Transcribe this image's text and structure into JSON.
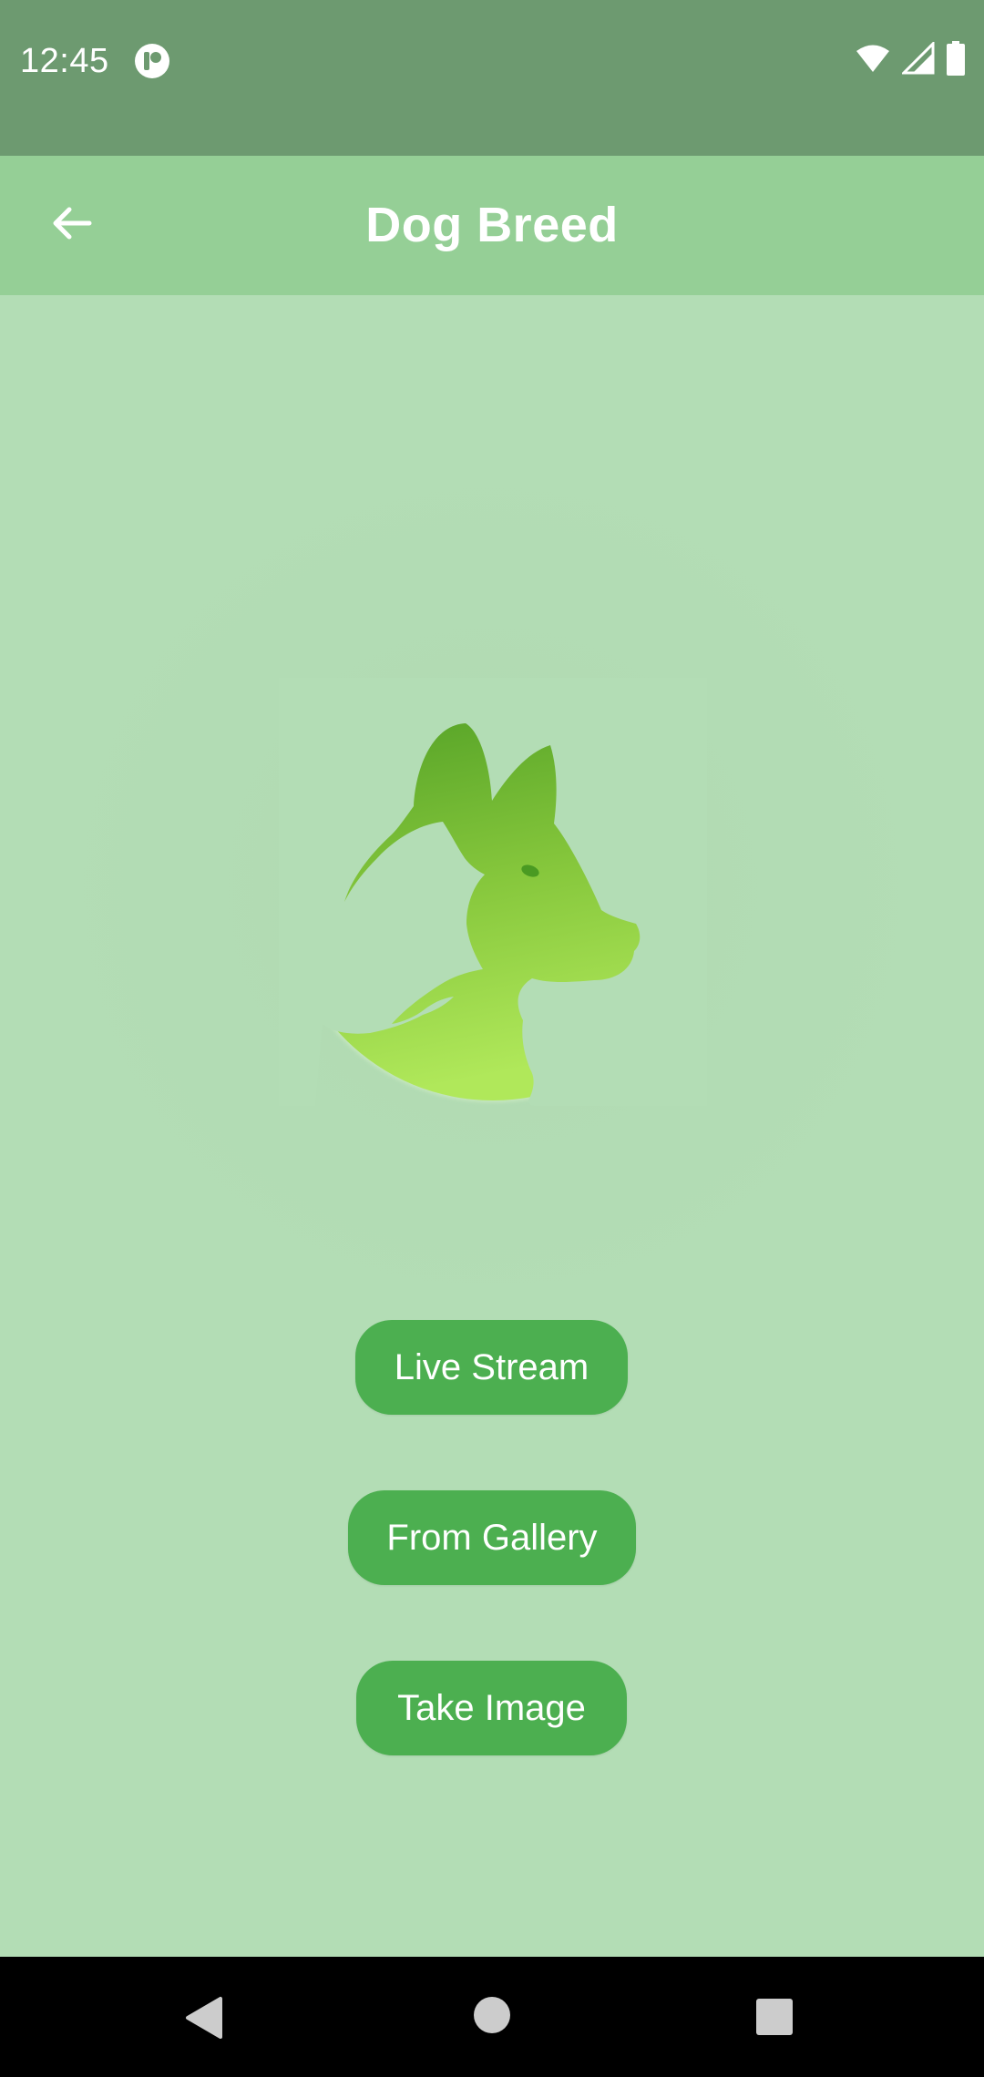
{
  "status_bar": {
    "time": "12:45",
    "icons": [
      "app-notification-icon",
      "wifi-icon",
      "cell-signal-icon",
      "battery-icon"
    ]
  },
  "app_bar": {
    "title": "Dog Breed",
    "back_icon": "arrow-back-icon"
  },
  "main": {
    "logo": "husky-dog-logo",
    "buttons": {
      "live_stream": "Live Stream",
      "from_gallery": "From Gallery",
      "take_image": "Take Image"
    }
  },
  "nav_bar": {
    "icons": [
      "nav-back-icon",
      "nav-home-icon",
      "nav-recents-icon"
    ]
  },
  "colors": {
    "status_bar": "#6d9a70",
    "app_bar": "#95cf96",
    "background": "#b3ddb5",
    "button": "#4caf50",
    "logo_gradient_top": "#4a9a22",
    "logo_gradient_bottom": "#b0e85a"
  }
}
